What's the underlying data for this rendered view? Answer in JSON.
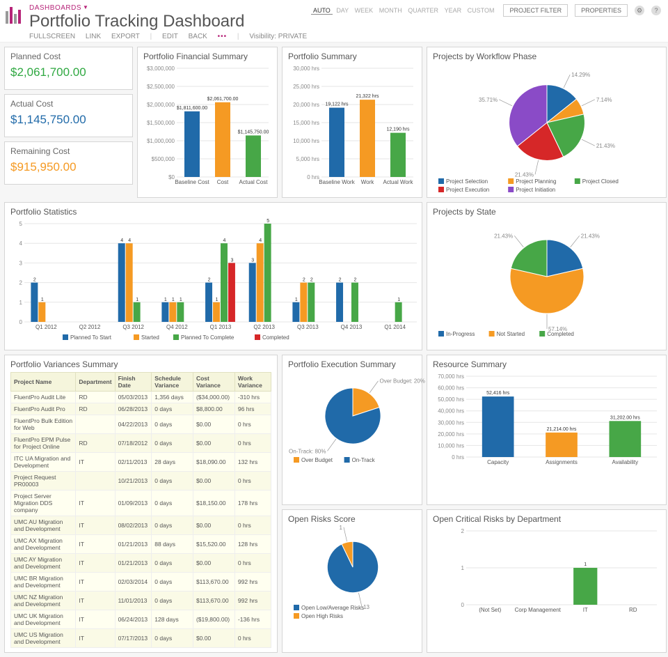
{
  "header": {
    "crumb": "DASHBOARDS",
    "title": "Portfolio Tracking Dashboard",
    "links": [
      "FULLSCREEN",
      "LINK",
      "EXPORT"
    ],
    "links2": [
      "EDIT",
      "BACK"
    ],
    "visibility": "Visibility: PRIVATE",
    "range": [
      "AUTO",
      "DAY",
      "WEEK",
      "MONTH",
      "QUARTER",
      "YEAR",
      "CUSTOM"
    ],
    "project_filter": "PROJECT FILTER",
    "properties": "PROPERTIES"
  },
  "kpi": {
    "planned_label": "Planned Cost",
    "planned_value": "$2,061,700.00",
    "actual_label": "Actual Cost",
    "actual_value": "$1,145,750.00",
    "remaining_label": "Remaining Cost",
    "remaining_value": "$915,950.00"
  },
  "chart_data": [
    {
      "id": "fin",
      "type": "bar",
      "title": "Portfolio Financial Summary",
      "categories": [
        "Baseline Cost",
        "Cost",
        "Actual Cost"
      ],
      "values": [
        1811600.0,
        2061700.0,
        1145750.0
      ],
      "value_labels": [
        "$1,811,600.00",
        "$2,061,700.00",
        "$1,145,750.00"
      ],
      "colors": [
        "#206aa9",
        "#f59a23",
        "#47a747"
      ],
      "yticks": [
        "$0",
        "$500,000",
        "$1,000,000",
        "$1,500,000",
        "$2,000,000",
        "$2,500,000",
        "$3,000,000"
      ],
      "ylim": [
        0,
        3000000
      ]
    },
    {
      "id": "summary",
      "type": "bar",
      "title": "Portfolio Summary",
      "categories": [
        "Baseline Work",
        "Work",
        "Actual Work"
      ],
      "values": [
        19122,
        21322,
        12190
      ],
      "value_labels": [
        "19,122 hrs",
        "21,322 hrs",
        "12,190 hrs"
      ],
      "colors": [
        "#206aa9",
        "#f59a23",
        "#47a747"
      ],
      "yticks": [
        "0 hrs",
        "5,000 hrs",
        "10,000 hrs",
        "15,000 hrs",
        "20,000 hrs",
        "25,000 hrs",
        "30,000 hrs"
      ],
      "ylim": [
        0,
        30000
      ]
    },
    {
      "id": "workflow",
      "type": "pie",
      "title": "Projects by Workflow Phase",
      "series": [
        {
          "name": "Project Selection",
          "value": 14.29,
          "label": "14.29%",
          "color": "#206aa9"
        },
        {
          "name": "Project Planning",
          "value": 7.14,
          "label": "7.14%",
          "color": "#f59a23"
        },
        {
          "name": "Project Closed",
          "value": 21.43,
          "label": "21.43%",
          "color": "#47a747"
        },
        {
          "name": "Project Execution",
          "value": 21.43,
          "label": "21.43%",
          "color": "#d62728"
        },
        {
          "name": "Project Initiation",
          "value": 35.71,
          "label": "35.71%",
          "color": "#8a4bc7"
        }
      ]
    },
    {
      "id": "stats",
      "type": "bar",
      "title": "Portfolio Statistics",
      "categories": [
        "Q1 2012",
        "Q2 2012",
        "Q3 2012",
        "Q4 2012",
        "Q1 2013",
        "Q2 2013",
        "Q3 2013",
        "Q4 2013",
        "Q1 2014"
      ],
      "series": [
        {
          "name": "Planned To Start",
          "color": "#206aa9",
          "values": [
            2,
            0,
            4,
            1,
            2,
            3,
            1,
            2,
            0
          ]
        },
        {
          "name": "Started",
          "color": "#f59a23",
          "values": [
            1,
            0,
            4,
            1,
            1,
            4,
            2,
            0,
            0
          ]
        },
        {
          "name": "Planned To Complete",
          "color": "#47a747",
          "values": [
            0,
            0,
            1,
            1,
            4,
            5,
            2,
            2,
            1
          ]
        },
        {
          "name": "Completed",
          "color": "#d62728",
          "values": [
            0,
            0,
            0,
            0,
            3,
            0,
            0,
            0,
            0
          ]
        }
      ],
      "yticks": [
        "0",
        "1",
        "2",
        "3",
        "4",
        "5"
      ],
      "ylim": [
        0,
        5
      ]
    },
    {
      "id": "state",
      "type": "pie",
      "title": "Projects by State",
      "series": [
        {
          "name": "In-Progress",
          "value": 21.43,
          "label": "21.43%",
          "color": "#206aa9"
        },
        {
          "name": "Not Started",
          "value": 57.14,
          "label": "57.14%",
          "color": "#f59a23"
        },
        {
          "name": "Completed",
          "value": 21.43,
          "label": "21.43%",
          "color": "#47a747"
        }
      ]
    },
    {
      "id": "exec",
      "type": "pie",
      "title": "Portfolio Execution Summary",
      "series": [
        {
          "name": "Over Budget",
          "value": 20,
          "label": "Over Budget: 20%",
          "color": "#f59a23"
        },
        {
          "name": "On-Track",
          "value": 80,
          "label": "On-Track: 80%",
          "color": "#206aa9"
        }
      ]
    },
    {
      "id": "resource",
      "type": "bar",
      "title": "Resource Summary",
      "categories": [
        "Capacity",
        "Assignments",
        "Availability"
      ],
      "values": [
        52416,
        21214.0,
        31202.0
      ],
      "value_labels": [
        "52,416 hrs",
        "21,214.00 hrs",
        "31,202.00 hrs"
      ],
      "colors": [
        "#206aa9",
        "#f59a23",
        "#47a747"
      ],
      "yticks": [
        "0 hrs",
        "10,000 hrs",
        "20,000 hrs",
        "30,000 hrs",
        "40,000 hrs",
        "50,000 hrs",
        "60,000 hrs",
        "70,000 hrs"
      ],
      "ylim": [
        0,
        70000
      ]
    },
    {
      "id": "risks",
      "type": "pie",
      "title": "Open Risks Score",
      "series": [
        {
          "name": "Open Low/Average Risks",
          "value": 13,
          "label": "13",
          "color": "#206aa9"
        },
        {
          "name": "Open High Risks",
          "value": 1,
          "label": "1",
          "color": "#f59a23"
        }
      ]
    },
    {
      "id": "riskdept",
      "type": "bar",
      "title": "Open Critical Risks by Department",
      "categories": [
        "(Not Set)",
        "Corp Management",
        "IT",
        "RD"
      ],
      "values": [
        0,
        0,
        1,
        0
      ],
      "value_labels": [
        "",
        "",
        "1",
        ""
      ],
      "colors": [
        "#47a747",
        "#47a747",
        "#47a747",
        "#47a747"
      ],
      "yticks": [
        "0",
        "1",
        "2"
      ],
      "ylim": [
        0,
        2
      ]
    }
  ],
  "variances": {
    "title": "Portfolio Variances Summary",
    "headers": [
      "Project Name",
      "Department",
      "Finish Date",
      "Schedule Variance",
      "Cost Variance",
      "Work Variance"
    ],
    "rows": [
      [
        "FluentPro Audit Lite",
        "RD",
        "05/03/2013",
        "1,356 days",
        "($34,000.00)",
        "-310 hrs"
      ],
      [
        "FluentPro Audit Pro",
        "RD",
        "06/28/2013",
        "0 days",
        "$8,800.00",
        "96 hrs"
      ],
      [
        "FluentPro Bulk Edition for Web",
        "",
        "04/22/2013",
        "0 days",
        "$0.00",
        "0 hrs"
      ],
      [
        "FluentPro EPM Pulse for Project Online",
        "RD",
        "07/18/2012",
        "0 days",
        "$0.00",
        "0 hrs"
      ],
      [
        "ITC UA Migration and Development",
        "IT",
        "02/11/2013",
        "28 days",
        "$18,090.00",
        "132 hrs"
      ],
      [
        "Project Request PR00003",
        "",
        "10/21/2013",
        "0 days",
        "$0.00",
        "0 hrs"
      ],
      [
        "Project Server Migration DDS company",
        "IT",
        "01/09/2013",
        "0 days",
        "$18,150.00",
        "178 hrs"
      ],
      [
        "UMC AU Migration and Development",
        "IT",
        "08/02/2013",
        "0 days",
        "$0.00",
        "0 hrs"
      ],
      [
        "UMC AX Migration and Development",
        "IT",
        "01/21/2013",
        "88 days",
        "$15,520.00",
        "128 hrs"
      ],
      [
        "UMC AY Migration and Development",
        "IT",
        "01/21/2013",
        "0 days",
        "$0.00",
        "0 hrs"
      ],
      [
        "UMC BR Migration and Development",
        "IT",
        "02/03/2014",
        "0 days",
        "$113,670.00",
        "992 hrs"
      ],
      [
        "UMC NZ Migration and Development",
        "IT",
        "11/01/2013",
        "0 days",
        "$113,670.00",
        "992 hrs"
      ],
      [
        "UMC UK Migration and Development",
        "IT",
        "06/24/2013",
        "128 days",
        "($19,800.00)",
        "-136 hrs"
      ],
      [
        "UMC US Migration and Development",
        "IT",
        "07/17/2013",
        "0 days",
        "$0.00",
        "0 hrs"
      ]
    ]
  }
}
